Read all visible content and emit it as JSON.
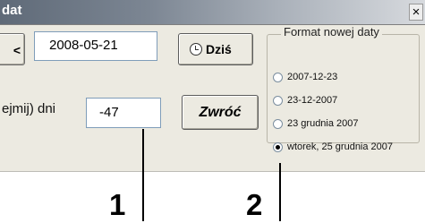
{
  "window": {
    "title": "dat",
    "close_label": "×"
  },
  "toolbar": {
    "partial_button_label": "<",
    "date_value": "2008-05-21",
    "today_label": "Dziś"
  },
  "days": {
    "label": "ejmij) dni",
    "value": "-47",
    "return_label": "Zwróć"
  },
  "format": {
    "group_title": "Format nowej daty",
    "options": [
      {
        "label": "2007-12-23",
        "selected": false
      },
      {
        "label": "23-12-2007",
        "selected": false
      },
      {
        "label": "23 grudnia 2007",
        "selected": false
      },
      {
        "label": "wtorek, 25 grudnia 2007",
        "selected": true
      }
    ]
  },
  "callouts": {
    "one": "1",
    "two": "2"
  }
}
